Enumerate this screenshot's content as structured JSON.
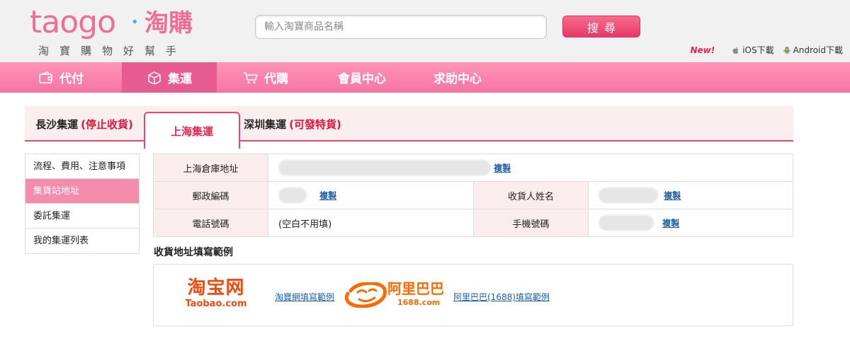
{
  "header": {
    "logo_text": "taogo",
    "logo_dot": "•",
    "logo_cn": "淘購",
    "slogan": "淘寶購物好幫手",
    "search_placeholder": "輸入淘寶商品名稱",
    "search_button": "搜尋",
    "new_badge": "New!",
    "ios_download": "iOS下載",
    "android_download": "Android下載"
  },
  "nav": {
    "items": [
      {
        "label": "代付",
        "icon": "wallet-icon"
      },
      {
        "label": "集運",
        "icon": "box-icon"
      },
      {
        "label": "代購",
        "icon": "cart-icon"
      },
      {
        "label": "會員中心"
      },
      {
        "label": "求助中心"
      }
    ]
  },
  "tabs": [
    {
      "label": "長沙集運",
      "status": "(停止收貨)"
    },
    {
      "label": "上海集運"
    },
    {
      "label": "深圳集運",
      "status": "(可發特貨)"
    }
  ],
  "side_menu": {
    "items": [
      "流程、費用、注意事項",
      "集貨站地址",
      "委託集運",
      "我的集運列表"
    ]
  },
  "address": {
    "warehouse_label": "上海倉庫地址",
    "postal_label": "郵政編碼",
    "recipient_label": "收貨人姓名",
    "phone_label": "電話號碼",
    "phone_value": "(空白不用填)",
    "mobile_label": "手機號碼",
    "copy_label": "複製"
  },
  "examples": {
    "title": "收貨地址填寫範例",
    "taobao_cn": "淘宝网",
    "taobao_en": "Taobao.com",
    "taobao_link": "淘寶網填寫範例",
    "alibaba_cn": "阿里巴巴",
    "alibaba_en": "1688.com",
    "alibaba_link": "阿里巴巴(1688)填寫範例"
  },
  "colors": {
    "brand_pink": "#ee6f96",
    "nav_pink": "#f574a2",
    "accent_red": "#e0173c",
    "link_blue": "#1a5fa8",
    "taobao_orange": "#f14b10",
    "alibaba_orange": "#ff6a00"
  }
}
